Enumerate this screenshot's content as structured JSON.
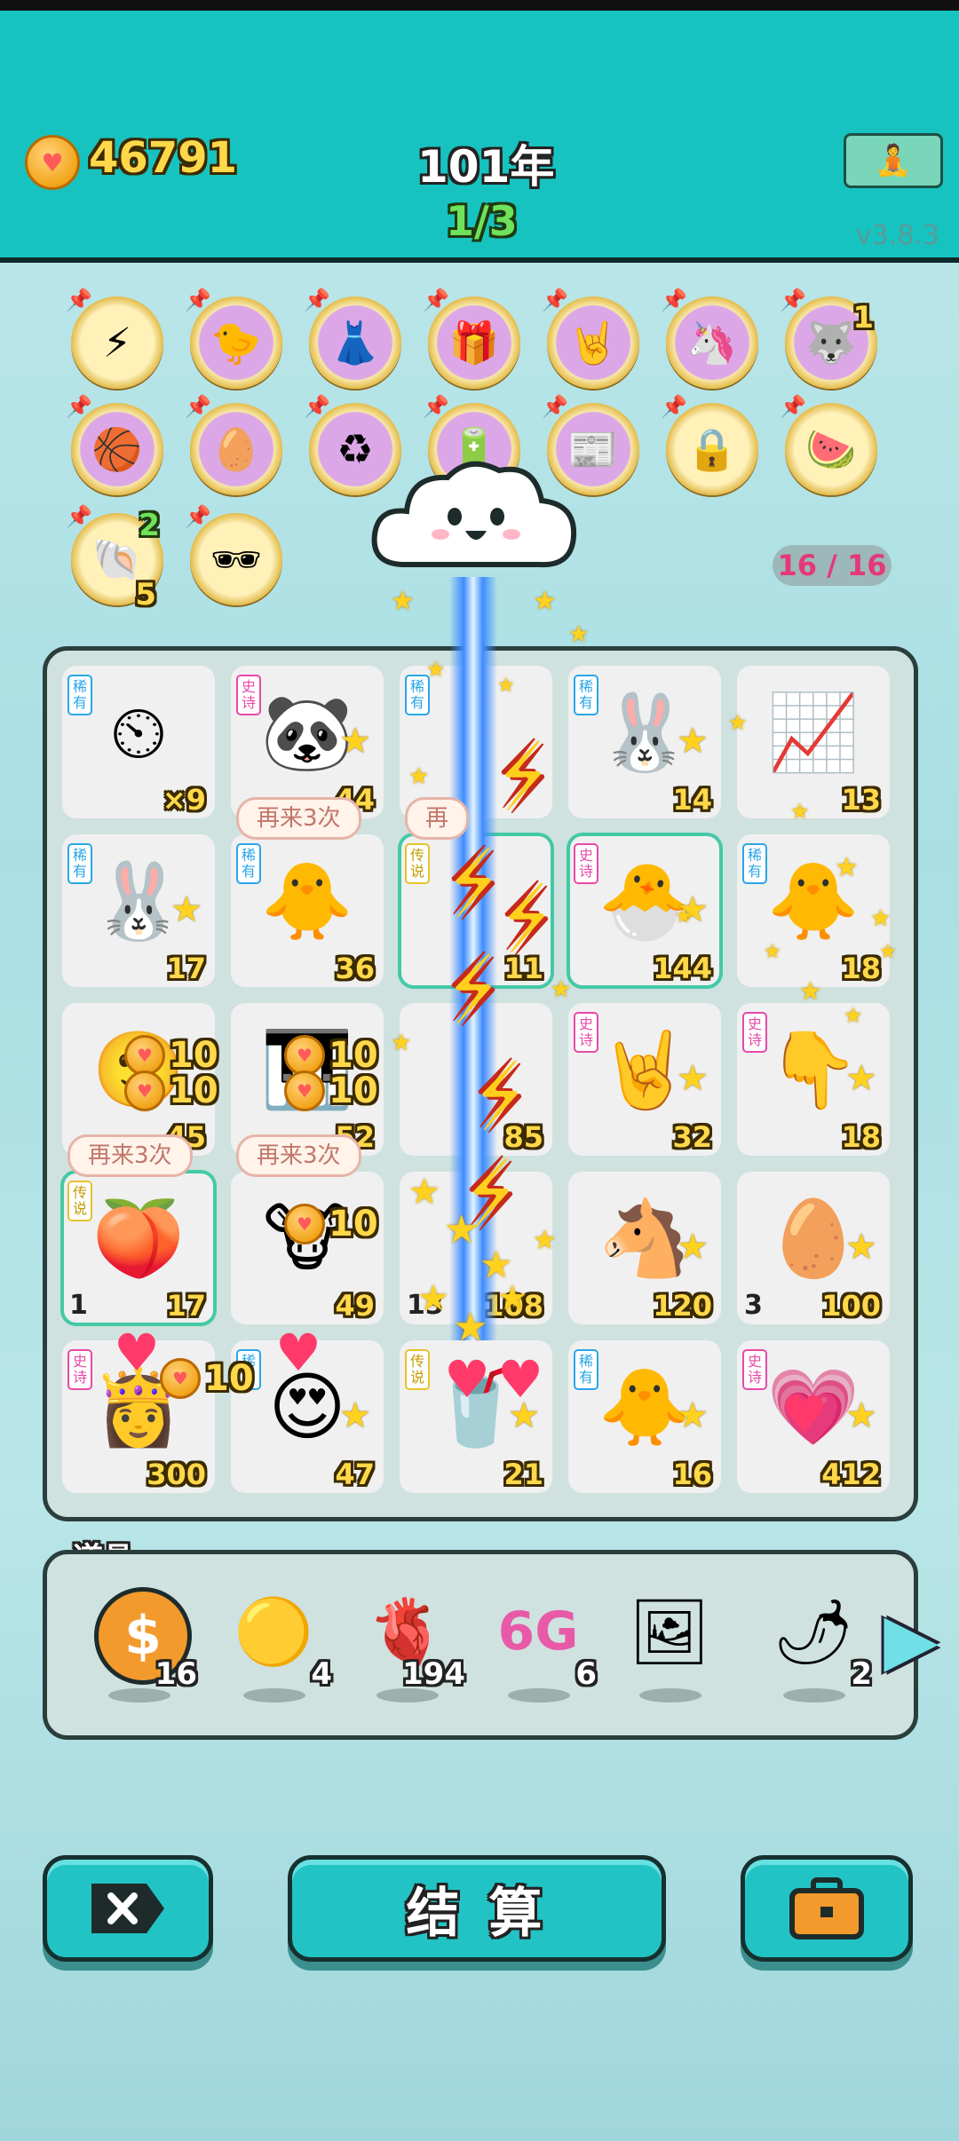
{
  "colors": {
    "header_bg": "#17c3c0",
    "accent": "#22c3c4",
    "gold": "#ffd84a",
    "rarity_rare": "#2ba6e8",
    "rarity_epic": "#e64aa8",
    "rarity_legend": "#e8c22b"
  },
  "header": {
    "coins": "46791",
    "year": "101年",
    "round": "1/3",
    "version": "v3.8.3",
    "meditate_icon": "meditation-icon"
  },
  "relics": {
    "count_label": "16 / 16",
    "items": [
      {
        "icon": "lightning-relic-icon",
        "glyph": "⚡",
        "count": ""
      },
      {
        "icon": "chick-egg-relic-icon",
        "glyph": "🐤",
        "count": ""
      },
      {
        "icon": "skirt-relic-icon",
        "glyph": "👗",
        "count": ""
      },
      {
        "icon": "gift-box-relic-icon",
        "glyph": "🎁",
        "count": ""
      },
      {
        "icon": "rock-hand-relic-icon",
        "glyph": "🤘",
        "count": ""
      },
      {
        "icon": "unicorn-relic-icon",
        "glyph": "🦄",
        "count": ""
      },
      {
        "icon": "husky-relic-icon",
        "glyph": "🐺",
        "count": "1"
      },
      {
        "icon": "basketballs-relic-icon",
        "glyph": "🏀",
        "count": ""
      },
      {
        "icon": "egg-face-relic-icon",
        "glyph": "🥚",
        "count": ""
      },
      {
        "icon": "recycle-relic-icon",
        "glyph": "♻",
        "count": ""
      },
      {
        "icon": "battery-relic-icon",
        "glyph": "🔋",
        "count": ""
      },
      {
        "icon": "time-magazine-relic-icon",
        "glyph": "📰",
        "count": ""
      },
      {
        "icon": "safe-relic-icon",
        "glyph": "🔒",
        "count": ""
      },
      {
        "icon": "fruit-platter-relic-icon",
        "glyph": "🍉",
        "count": ""
      },
      {
        "icon": "seashell-relic-icon",
        "glyph": "🐚",
        "count_top": "2",
        "count": "5"
      },
      {
        "icon": "sunglasses-peach-relic-icon",
        "glyph": "🕶",
        "count": ""
      }
    ]
  },
  "board": {
    "cells": [
      {
        "rarity": "稀有",
        "rarity_class": "blue",
        "icon": "speedometer-icon",
        "glyph": "⏲",
        "value": "×9",
        "level": "",
        "bubble": ""
      },
      {
        "rarity": "史诗",
        "rarity_class": "pink",
        "icon": "panda-icon",
        "glyph": "🐼",
        "value": "44",
        "level": "",
        "bubble": ""
      },
      {
        "rarity": "稀有",
        "rarity_class": "blue",
        "icon": "bolt-covered-icon",
        "glyph": "",
        "value": "",
        "level": "",
        "bubble": ""
      },
      {
        "rarity": "稀有",
        "rarity_class": "blue",
        "icon": "bunny-icon",
        "glyph": "🐰",
        "value": "14",
        "level": "",
        "bubble": ""
      },
      {
        "rarity": "",
        "rarity_class": "",
        "icon": "stock-chart-icon",
        "glyph": "📈",
        "value": "13",
        "level": "",
        "bubble": ""
      },
      {
        "rarity": "稀有",
        "rarity_class": "blue",
        "icon": "bunny-icon",
        "glyph": "🐰",
        "value": "17",
        "level": "",
        "bubble": ""
      },
      {
        "rarity": "稀有",
        "rarity_class": "blue",
        "icon": "chick-icon",
        "glyph": "🐥",
        "value": "36",
        "level": "",
        "bubble": "再来3次"
      },
      {
        "rarity": "传说",
        "rarity_class": "yellow",
        "icon": "legend-item-icon",
        "glyph": "",
        "value": "11",
        "level": "",
        "bubble": "再"
      },
      {
        "rarity": "史诗",
        "rarity_class": "pink",
        "icon": "gray-hair-chick-icon",
        "glyph": "🐣",
        "value": "144",
        "level": "",
        "bubble": ""
      },
      {
        "rarity": "稀有",
        "rarity_class": "blue",
        "icon": "sparkling-chick-icon",
        "glyph": "🐥",
        "value": "18",
        "level": "",
        "bubble": ""
      },
      {
        "rarity": "",
        "rarity_class": "",
        "icon": "face-coins-icon",
        "glyph": "🙂",
        "value": "45",
        "level": "",
        "bubble": ""
      },
      {
        "rarity": "",
        "rarity_class": "",
        "icon": "piano-icon",
        "glyph": "🎹",
        "value": "52",
        "level": "",
        "bubble": ""
      },
      {
        "rarity": "",
        "rarity_class": "",
        "icon": "bolt-covered-icon",
        "glyph": "",
        "value": "85",
        "level": "",
        "bubble": ""
      },
      {
        "rarity": "史诗",
        "rarity_class": "pink",
        "icon": "rock-hand-icon",
        "glyph": "🤘",
        "value": "32",
        "level": "",
        "bubble": ""
      },
      {
        "rarity": "史诗",
        "rarity_class": "pink",
        "icon": "pointing-hand-icon",
        "glyph": "👇",
        "value": "18",
        "level": "",
        "bubble": ""
      },
      {
        "rarity": "传说",
        "rarity_class": "yellow",
        "icon": "crowned-peaches-icon",
        "glyph": "🍑",
        "value": "17",
        "level": "1",
        "bubble": "再来3次"
      },
      {
        "rarity": "",
        "rarity_class": "",
        "icon": "cow-coins-icon",
        "glyph": "🐮",
        "value": "49",
        "level": "",
        "bubble": "再来3次"
      },
      {
        "rarity": "",
        "rarity_class": "",
        "icon": "star-burst-icon",
        "glyph": "",
        "value": "108",
        "level": "13",
        "bubble": ""
      },
      {
        "rarity": "",
        "rarity_class": "",
        "icon": "pony-icon",
        "glyph": "🐴",
        "value": "120",
        "level": "",
        "bubble": ""
      },
      {
        "rarity": "",
        "rarity_class": "",
        "icon": "egg-icon",
        "glyph": "🥚",
        "value": "100",
        "level": "3",
        "bubble": ""
      },
      {
        "rarity": "史诗",
        "rarity_class": "pink",
        "icon": "princess-icon",
        "glyph": "👸",
        "value": "300",
        "level": "",
        "bubble": ""
      },
      {
        "rarity": "稀有",
        "rarity_class": "blue",
        "icon": "heart-eyes-face-icon",
        "glyph": "😍",
        "value": "47",
        "level": "",
        "bubble": ""
      },
      {
        "rarity": "传说",
        "rarity_class": "yellow",
        "icon": "milk-tea-icon",
        "glyph": "🥤",
        "value": "21",
        "level": "",
        "bubble": ""
      },
      {
        "rarity": "稀有",
        "rarity_class": "blue",
        "icon": "chick-icon",
        "glyph": "🐥",
        "value": "16",
        "level": "",
        "bubble": ""
      },
      {
        "rarity": "史诗",
        "rarity_class": "pink",
        "icon": "heart-face-icon",
        "glyph": "💗",
        "value": "412",
        "level": "",
        "bubble": ""
      }
    ],
    "coin_popups": [
      "10",
      "10",
      "10",
      "10",
      "10",
      "10"
    ]
  },
  "tools": {
    "label": "道具",
    "items": [
      {
        "icon": "dollar-coin-icon",
        "glyph": "$",
        "count": "16"
      },
      {
        "icon": "gold-ball-icon",
        "glyph": "🟡",
        "count": "4"
      },
      {
        "icon": "liver-icon",
        "glyph": "🫀",
        "count": "194"
      },
      {
        "icon": "6g-icon",
        "glyph": "6G",
        "count": "6"
      },
      {
        "icon": "framed-portrait-icon",
        "glyph": "🖼",
        "count": ""
      },
      {
        "icon": "chili-pepper-icon",
        "glyph": "🌶",
        "count": "2"
      }
    ],
    "next_icon": "chevron-right-icon"
  },
  "bottom": {
    "cancel_icon": "close-x-icon",
    "settle_label": "结 算",
    "bag_icon": "briefcase-icon"
  }
}
